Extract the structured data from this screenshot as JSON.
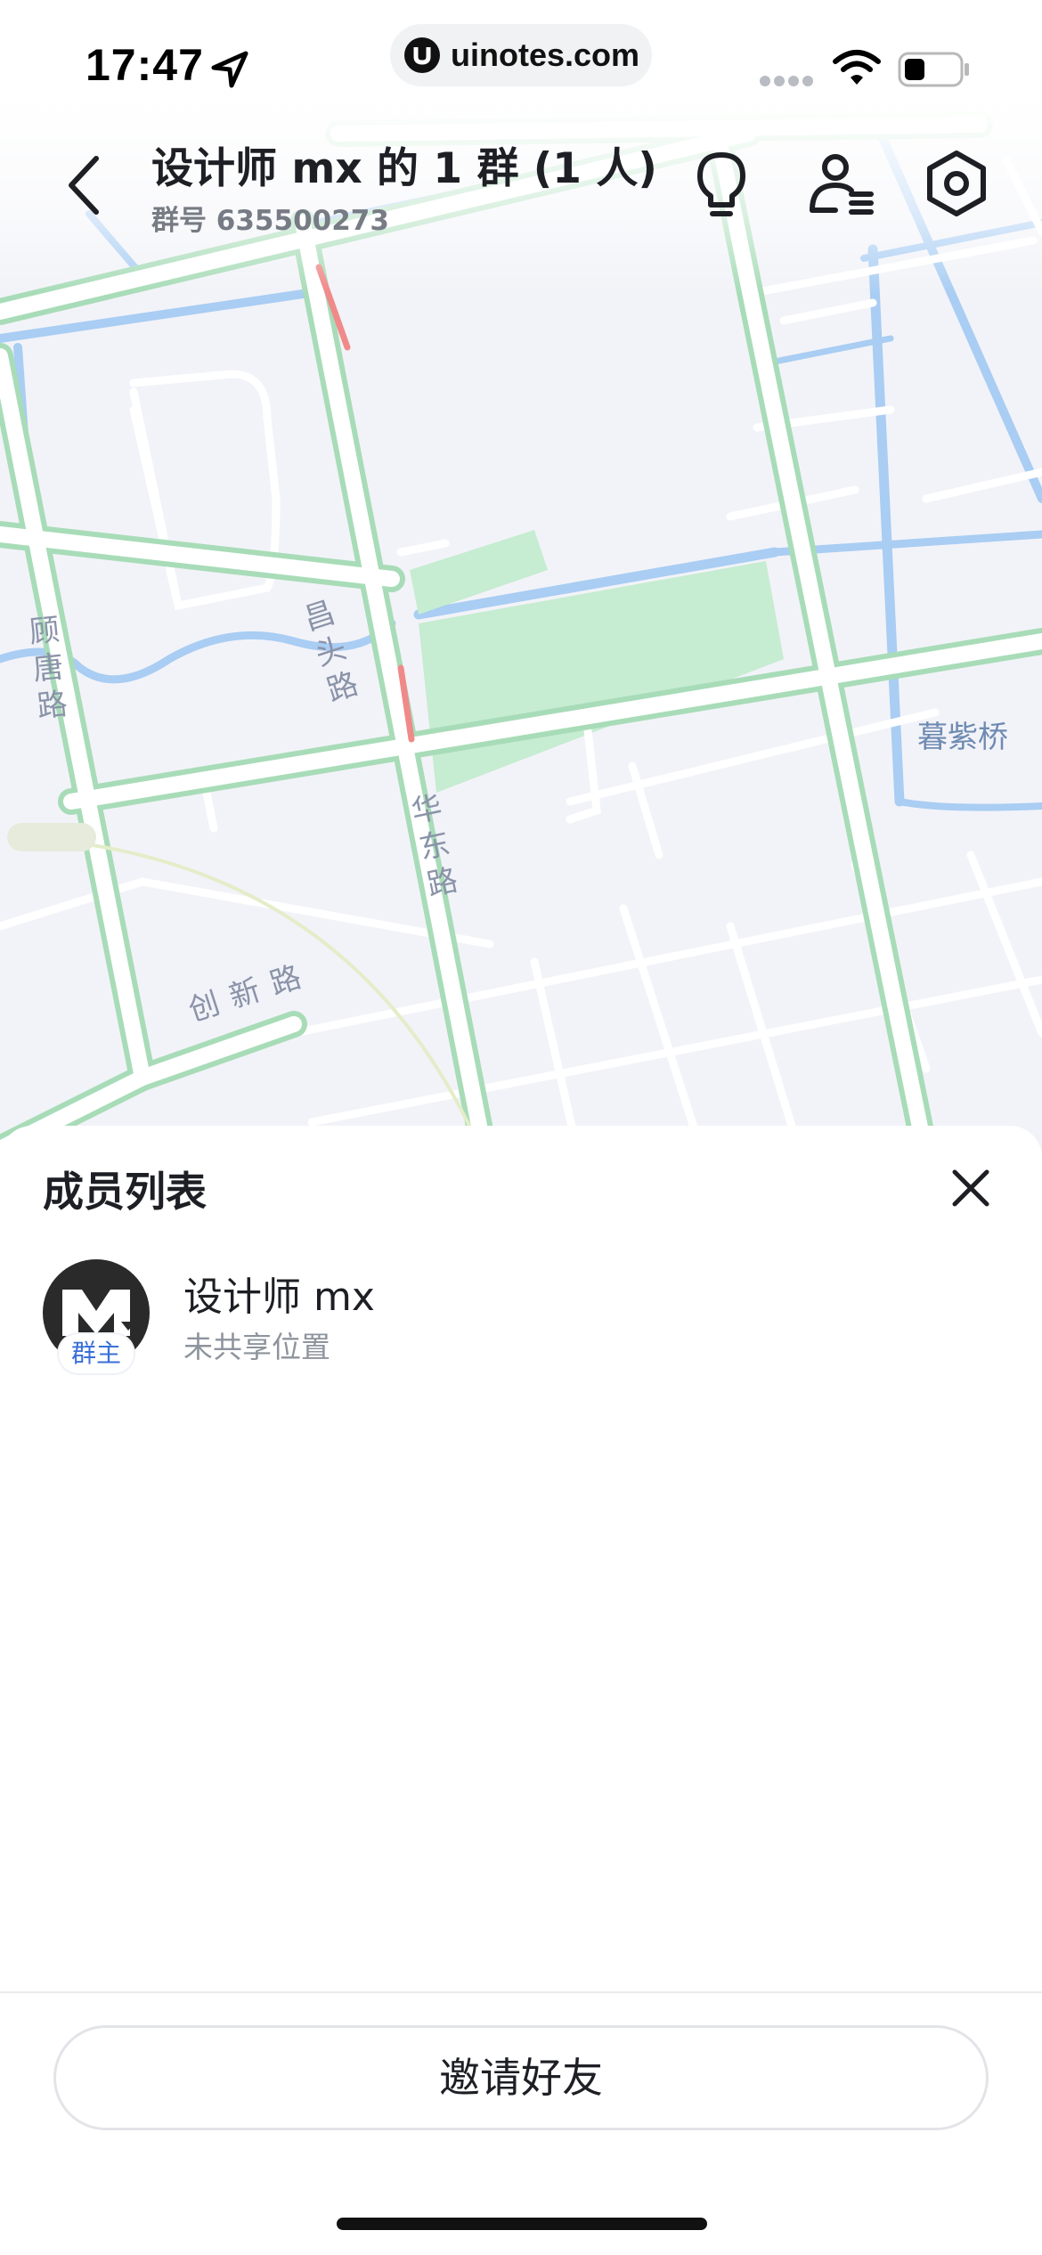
{
  "status_bar": {
    "time": "17:47",
    "url": "uinotes.com",
    "icons": [
      "location-arrow-icon",
      "cellular-signal-icon",
      "wifi-icon",
      "battery-icon"
    ]
  },
  "header": {
    "title": "设计师 mx 的 1 群 (1 人)",
    "group_number": "群号 635500273",
    "icons": [
      "back-chevron-icon",
      "lightbulb-icon",
      "member-list-icon",
      "settings-hexagon-icon"
    ]
  },
  "map": {
    "road_labels": [
      "顾唐路",
      "昌头路",
      "华东路",
      "创新路"
    ],
    "place_labels": [
      "暮紫桥"
    ]
  },
  "member_sheet": {
    "title": "成员列表",
    "close_icon": "close-icon",
    "members": [
      {
        "name": "设计师 mx",
        "status": "未共享位置",
        "badge": "群主"
      }
    ],
    "invite_label": "邀请好友"
  },
  "colors": {
    "road_casing": "#a8dcb8",
    "water": "#a9cdf3",
    "park": "#c6ecd1",
    "congestion": "#f08a8a",
    "badge_text": "#3a6fd8"
  }
}
